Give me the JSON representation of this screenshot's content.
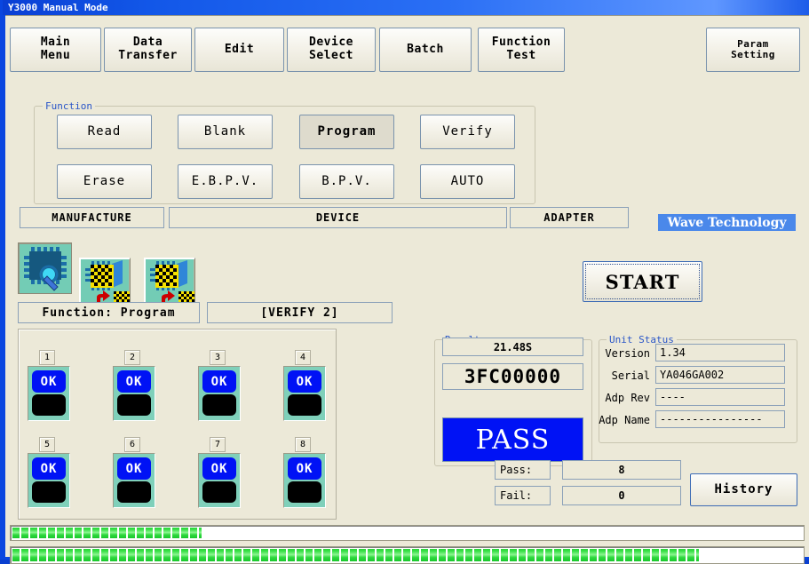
{
  "window": {
    "title": "Y3000 Manual Mode"
  },
  "toolbar": {
    "buttons": [
      {
        "label": "Main\nMenu",
        "name": "main-menu"
      },
      {
        "label": "Data\nTransfer",
        "name": "data-transfer"
      },
      {
        "label": "Edit",
        "name": "edit"
      },
      {
        "label": "Device\nSelect",
        "name": "device-select"
      },
      {
        "label": "Batch",
        "name": "batch"
      },
      {
        "label": "Function\nTest",
        "name": "function-test"
      }
    ],
    "param_setting": "Param\nSetting"
  },
  "function_group": {
    "legend": "Function",
    "buttons": [
      {
        "label": "Read",
        "selected": false
      },
      {
        "label": "Blank",
        "selected": false
      },
      {
        "label": "Program",
        "selected": true
      },
      {
        "label": "Verify",
        "selected": false
      },
      {
        "label": "Erase",
        "selected": false
      },
      {
        "label": "E.B.P.V.",
        "selected": false
      },
      {
        "label": "B.P.V.",
        "selected": false
      },
      {
        "label": "AUTO",
        "selected": false
      }
    ]
  },
  "info_row": {
    "manufacture": "MANUFACTURE",
    "device": "DEVICE",
    "adapter": "ADAPTER",
    "logo": "Wave Technology"
  },
  "icon_buttons": [
    {
      "name": "chip-inspect-icon",
      "selected": true
    },
    {
      "name": "chip-read-data-icon",
      "selected": false
    },
    {
      "name": "chip-write-data-icon",
      "selected": false
    }
  ],
  "start_button": {
    "label": "START"
  },
  "status_row": {
    "function": "Function: Program",
    "verify": "[VERIFY 2]"
  },
  "sockets": [
    {
      "number": "1",
      "state": "OK"
    },
    {
      "number": "2",
      "state": "OK"
    },
    {
      "number": "3",
      "state": "OK"
    },
    {
      "number": "4",
      "state": "OK"
    },
    {
      "number": "5",
      "state": "OK"
    },
    {
      "number": "6",
      "state": "OK"
    },
    {
      "number": "7",
      "state": "OK"
    },
    {
      "number": "8",
      "state": "OK"
    }
  ],
  "result": {
    "legend": "Result",
    "time": "21.48S",
    "checksum": "3FC00000",
    "verdict": "PASS"
  },
  "unit_status": {
    "legend": "Unit Status",
    "rows": [
      {
        "label": "Version",
        "value": "1.34"
      },
      {
        "label": "Serial",
        "value": "YA046GA002"
      },
      {
        "label": "Adp Rev",
        "value": "----"
      },
      {
        "label": "Adp Name",
        "value": "----------------"
      }
    ]
  },
  "counters": {
    "pass_label": "Pass:",
    "pass_value": "8",
    "fail_label": "Fail:",
    "fail_value": "0"
  },
  "history_button": {
    "label": "History"
  },
  "progress": {
    "top_percent": 24,
    "bottom_percent": 87
  },
  "colors": {
    "face": "#ece9d8",
    "accent_blue": "#0012f5",
    "logo_blue": "#4a88ea",
    "progress_green": "#2fd93e",
    "socket_teal": "#7fd0ba"
  }
}
